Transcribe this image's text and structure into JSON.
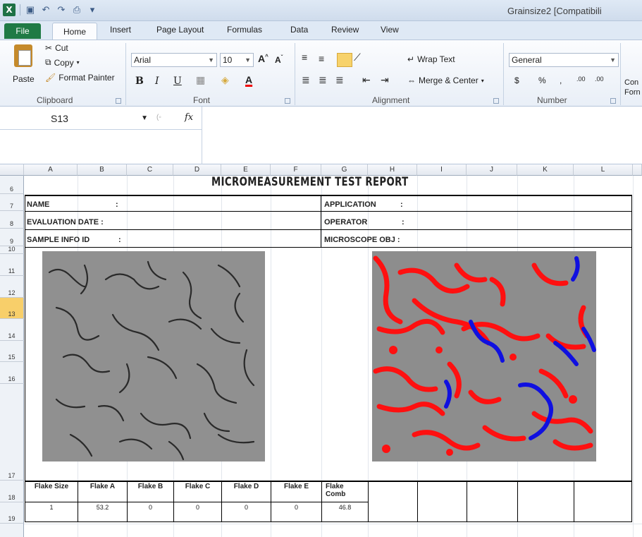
{
  "window": {
    "title": "Grainsize2  [Compatibili",
    "app_logo": "X"
  },
  "tabs": [
    "File",
    "Home",
    "Insert",
    "Page Layout",
    "Formulas",
    "Data",
    "Review",
    "View"
  ],
  "ribbon": {
    "clipboard": {
      "paste": "Paste",
      "cut": "Cut",
      "copy": "Copy",
      "format_painter": "Format Painter",
      "group_label": "Clipboard"
    },
    "font": {
      "name": "Arial",
      "size": "10",
      "group_label": "Font",
      "bold": "B",
      "italic": "I",
      "underline": "U"
    },
    "alignment": {
      "wrap_text": "Wrap Text",
      "merge_center": "Merge & Center",
      "group_label": "Alignment"
    },
    "number": {
      "format": "General",
      "currency": "$",
      "percent": "%",
      "comma": ",",
      "inc_dec": ".00",
      "group_label": "Number"
    },
    "styles": {
      "conditional": "Con",
      "format": "Forn"
    }
  },
  "formula_bar": {
    "name_box": "S13",
    "fx": "fx",
    "content": ""
  },
  "columns": [
    "A",
    "B",
    "C",
    "D",
    "E",
    "F",
    "G",
    "H",
    "I",
    "J",
    "K",
    "L"
  ],
  "rows": [
    "6",
    "7",
    "8",
    "9",
    "10",
    "11",
    "12",
    "13",
    "14",
    "15",
    "16",
    "17",
    "18",
    "19"
  ],
  "selected_row": "13",
  "report": {
    "title": "MICROMEASUREMENT  TEST  REPORT",
    "name_label": "NAME",
    "name_colon": ":",
    "evaluation_date_label": "EVALUATION DATE :",
    "sample_info_label": "SAMPLE INFO ID",
    "sample_info_colon": ":",
    "application_label": "APPLICATION",
    "application_colon": ":",
    "operator_label": "OPERATOR",
    "operator_colon": ":",
    "microscope_label": "MICROSCOPE OBJ :"
  },
  "flake_table": {
    "headers": [
      "Flake Size",
      "Flake A",
      "Flake B",
      "Flake C",
      "Flake D",
      "Flake E",
      "Flake Comb"
    ],
    "values": [
      "1",
      "53.2",
      "0",
      "0",
      "0",
      "0",
      "46.8"
    ]
  },
  "colors": {
    "excel_green": "#1f7a45",
    "red_phase": "#ff1010",
    "blue_phase": "#1010e0",
    "gray_bg": "#8a8a8a"
  }
}
